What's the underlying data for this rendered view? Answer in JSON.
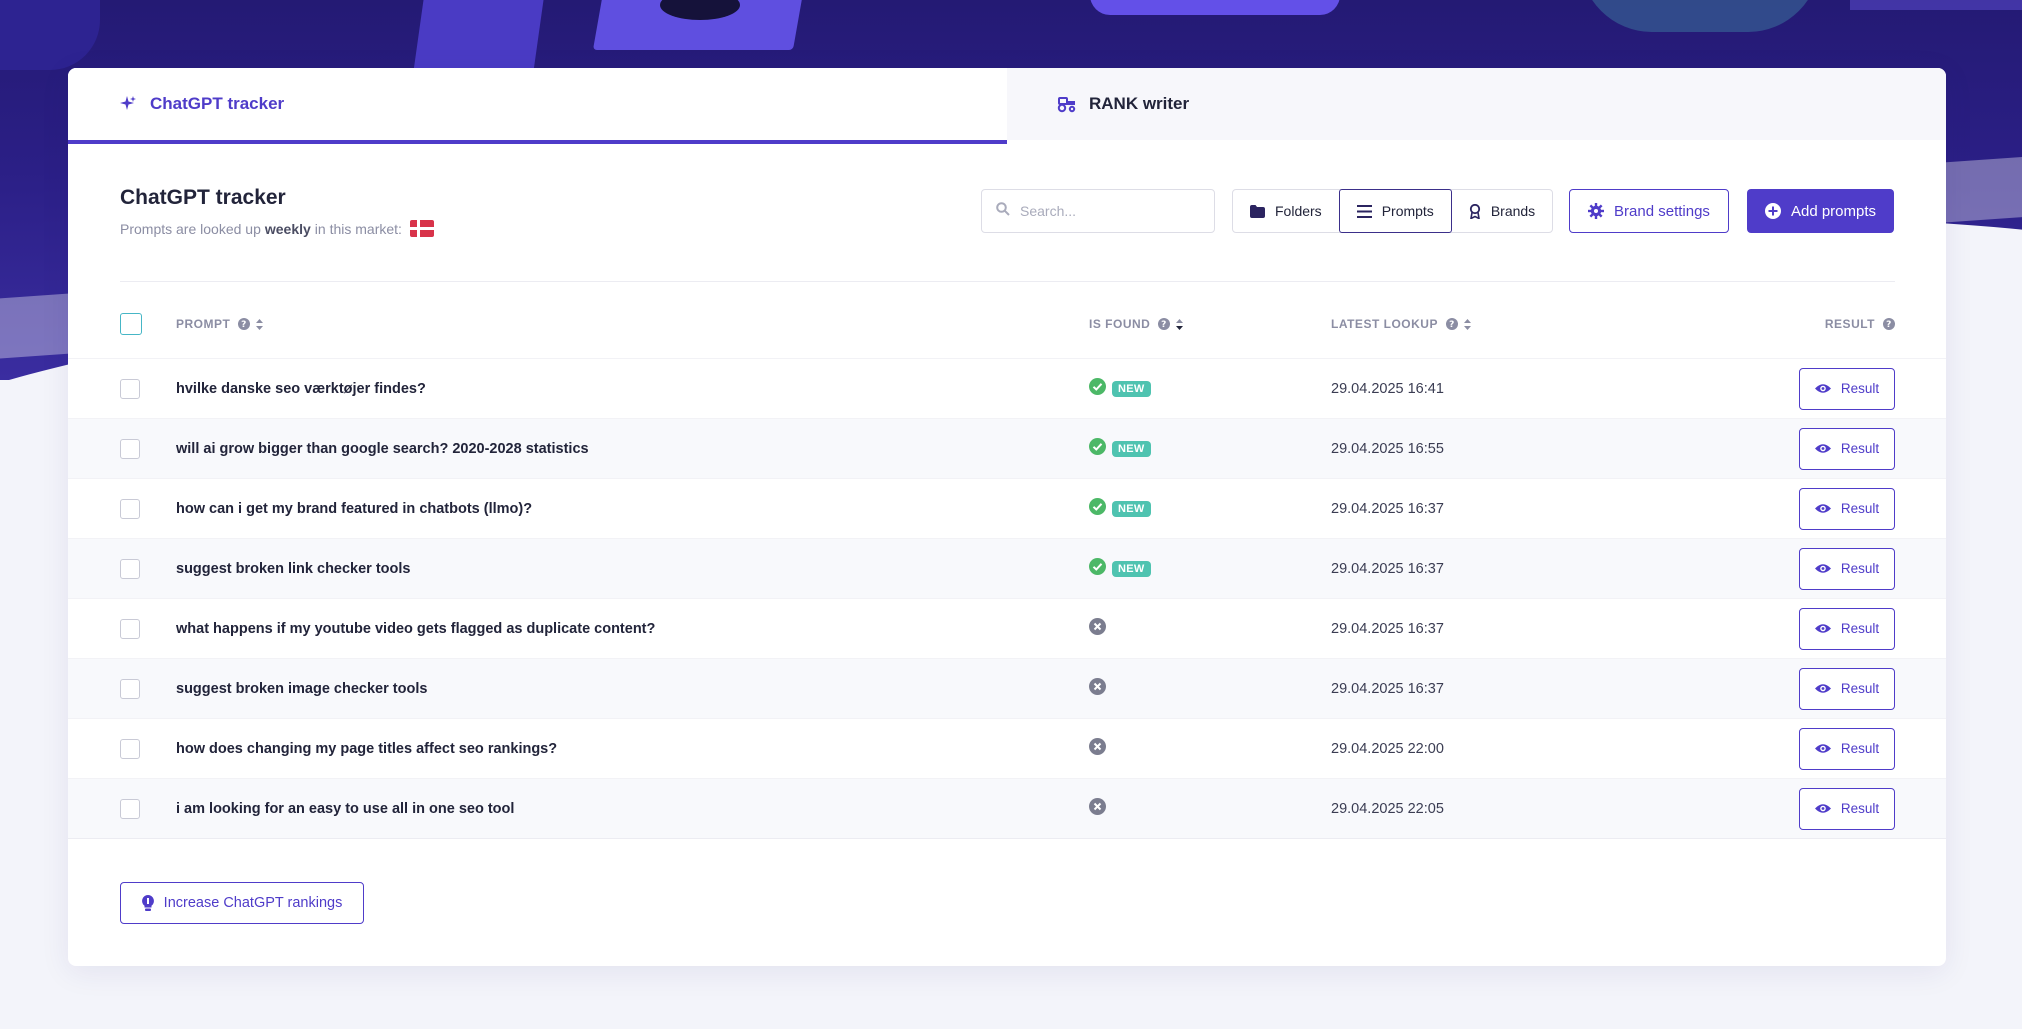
{
  "tabs": [
    {
      "label": "ChatGPT tracker",
      "icon": "sparkle-icon",
      "active": true
    },
    {
      "label": "RANK writer",
      "icon": "tractor-icon",
      "active": false
    }
  ],
  "header": {
    "title": "ChatGPT tracker",
    "subtitle_prefix": "Prompts are looked up",
    "subtitle_bold": "weekly",
    "subtitle_suffix": "in this market:",
    "market_flag": "denmark-flag-icon"
  },
  "search": {
    "placeholder": "Search..."
  },
  "view_toggle": {
    "folders": "Folders",
    "prompts": "Prompts",
    "brands": "Brands",
    "selected": "Prompts"
  },
  "actions": {
    "brand_settings": "Brand settings",
    "add_prompts": "Add prompts"
  },
  "table": {
    "headers": {
      "prompt": "PROMPT",
      "is_found": "IS FOUND",
      "latest_lookup": "LATEST LOOKUP",
      "result": "RESULT"
    },
    "result_label": "Result",
    "new_label": "NEW",
    "rows": [
      {
        "prompt": "hvilke danske seo værktøjer findes?",
        "found": true,
        "date": "29.04.2025 16:41"
      },
      {
        "prompt": "will ai grow bigger than google search? 2020-2028 statistics",
        "found": true,
        "date": "29.04.2025 16:55"
      },
      {
        "prompt": "how can i get my brand featured in chatbots (llmo)?",
        "found": true,
        "date": "29.04.2025 16:37"
      },
      {
        "prompt": "suggest broken link checker tools",
        "found": true,
        "date": "29.04.2025 16:37"
      },
      {
        "prompt": "what happens if my youtube video gets flagged as duplicate content?",
        "found": false,
        "date": "29.04.2025 16:37"
      },
      {
        "prompt": "suggest broken image checker tools",
        "found": false,
        "date": "29.04.2025 16:37"
      },
      {
        "prompt": "how does changing my page titles affect seo rankings?",
        "found": false,
        "date": "29.04.2025 22:00"
      },
      {
        "prompt": "i am looking for an easy to use all in one seo tool",
        "found": false,
        "date": "29.04.2025 22:05"
      }
    ]
  },
  "footer": {
    "increase_button": "Increase ChatGPT rankings"
  },
  "colors": {
    "accent": "#4f3cc9",
    "found": "#4cb867",
    "not_found": "#7b7d8f",
    "new_badge": "#4fc3b0"
  }
}
